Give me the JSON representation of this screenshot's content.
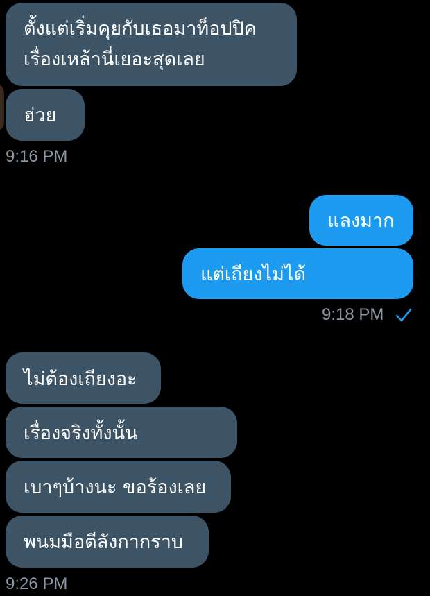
{
  "accent_color": "#1d9bf0",
  "incoming_bubble_color": "#3d5466",
  "timestamp_color": "#8b98a5",
  "messages": [
    {
      "direction": "incoming",
      "lines": [
        "ตั้งแต่เริ่มคุยกับเธอมาท็อปปิค",
        "เรื่องเหล้านี่เยอะสุดเลย"
      ]
    },
    {
      "direction": "incoming",
      "text": "ฮ่วย"
    },
    {
      "direction": "outgoing",
      "text": "แลงมาก"
    },
    {
      "direction": "outgoing",
      "text": "แต่เถียงไม่ได้"
    },
    {
      "direction": "incoming",
      "text": "ไม่ต้องเถียงอะ"
    },
    {
      "direction": "incoming",
      "text": "เรื่องจริงทั้งนั้น"
    },
    {
      "direction": "incoming",
      "text": "เบาๆบ้างนะ ขอร้องเลย"
    },
    {
      "direction": "incoming",
      "text": "พนมมือตีลังกากราบ"
    }
  ],
  "timestamps": {
    "first_group": "9:16 PM",
    "second_group": "9:18 PM",
    "third_group": "9:26 PM"
  },
  "icons": {
    "read_receipt": "check-icon"
  }
}
